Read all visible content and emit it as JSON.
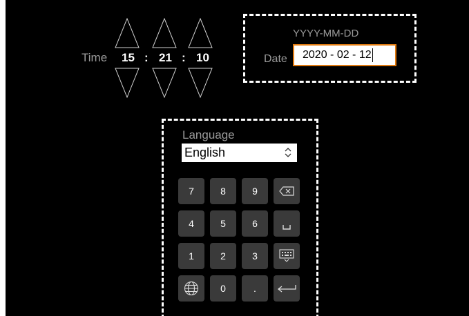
{
  "time": {
    "label": "Time",
    "hours": "15",
    "minutes": "21",
    "seconds": "10",
    "separator": ":"
  },
  "date": {
    "format_hint": "YYYY-MM-DD",
    "label": "Date",
    "value": "2020 - 02 - 12"
  },
  "language": {
    "label": "Language",
    "selected": "English"
  },
  "keypad": {
    "keys": [
      "7",
      "8",
      "9",
      "4",
      "5",
      "6",
      "1",
      "2",
      "3",
      "0",
      "."
    ],
    "icons": [
      "backspace-icon",
      "space-icon",
      "keyboard-icon",
      "globe-icon",
      "enter-icon"
    ]
  }
}
